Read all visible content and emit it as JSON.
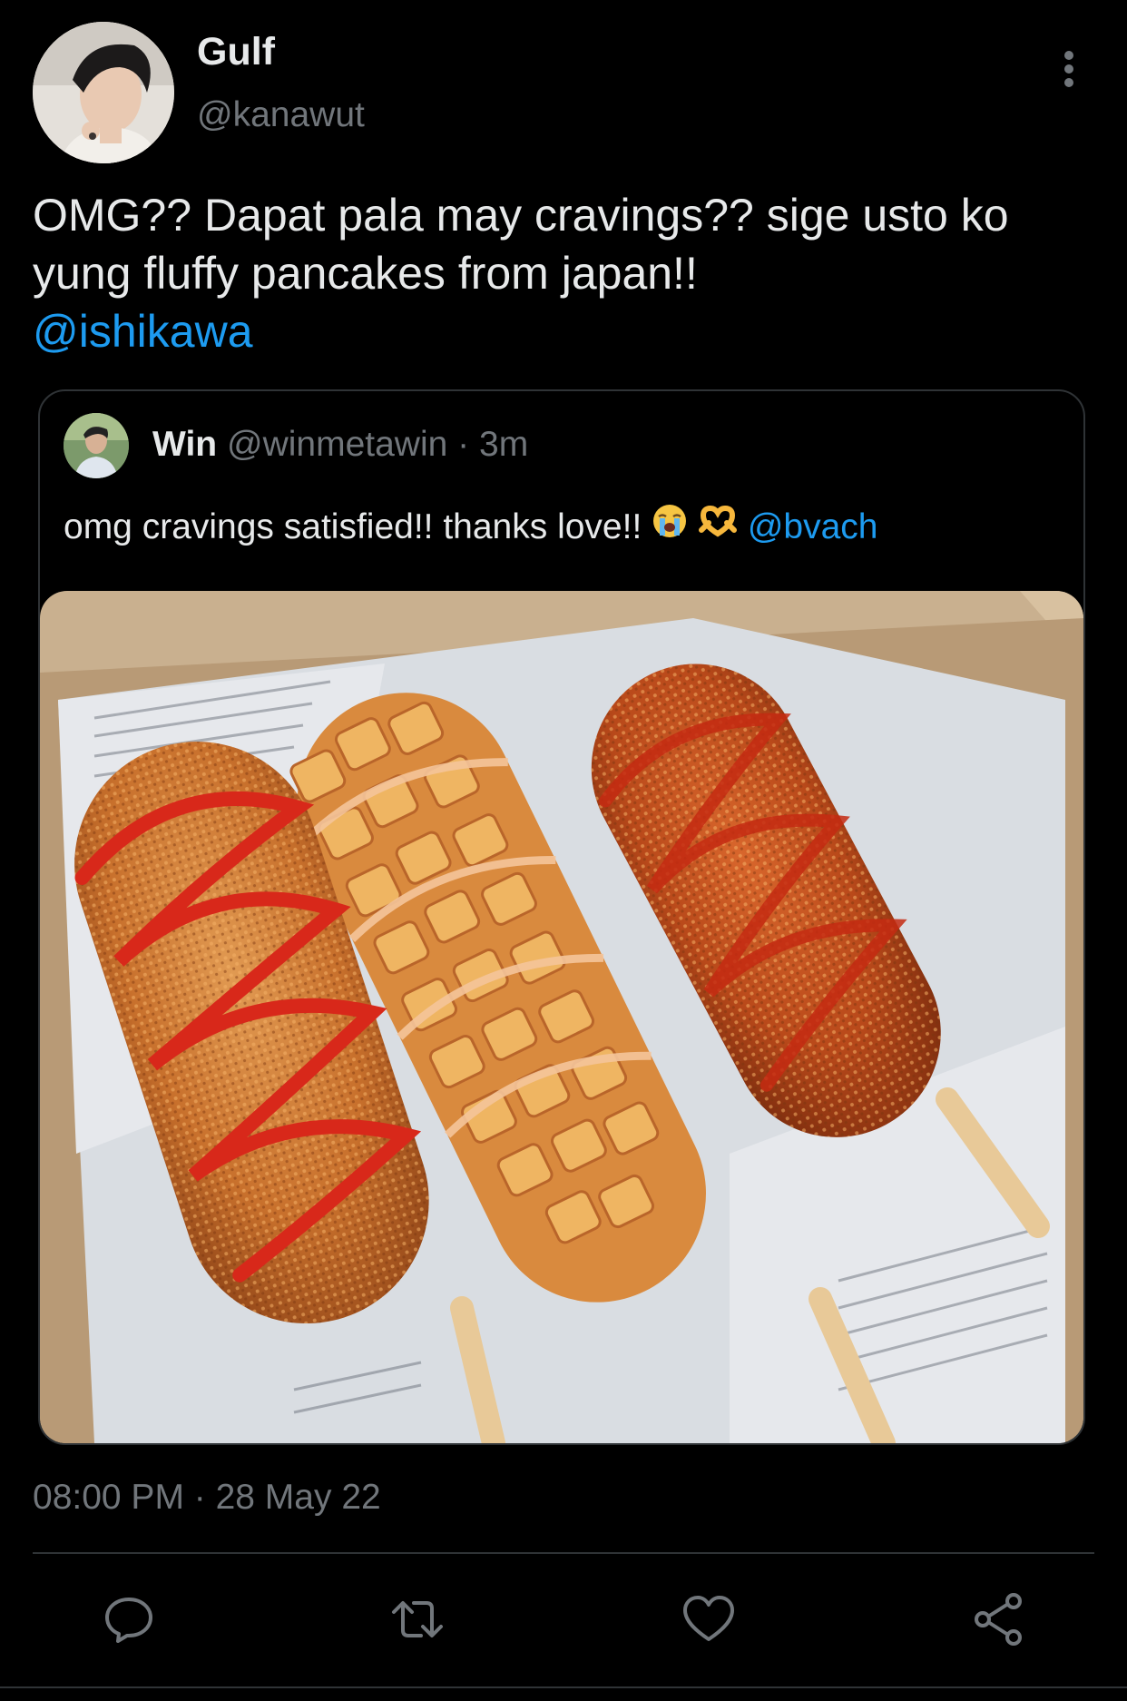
{
  "author": {
    "name": "Gulf",
    "handle": "@kanawut"
  },
  "tweet": {
    "text": "OMG?? Dapat pala may cravings?? sige usto ko yung fluffy pancakes from japan!!",
    "mention": "@ishikawa"
  },
  "quoted": {
    "name": "Win",
    "handle": "@winmetawin",
    "separator": "·",
    "time": "3m",
    "text": "omg cravings satisfied!! thanks love!!",
    "emojis": [
      "loudly-crying-face",
      "heart-hands"
    ],
    "mention": "@bvach",
    "photo_subject": "three-corn-dogs-in-box"
  },
  "timestamp": "08:00 PM · 28 May 22",
  "actions": [
    {
      "icon": "reply-icon"
    },
    {
      "icon": "retweet-icon"
    },
    {
      "icon": "like-icon"
    },
    {
      "icon": "share-icon"
    }
  ],
  "colors": {
    "background": "#000000",
    "text": "#e7e9ea",
    "secondary": "#71767b",
    "accent": "#1d9bf0",
    "border": "#2f3336"
  }
}
